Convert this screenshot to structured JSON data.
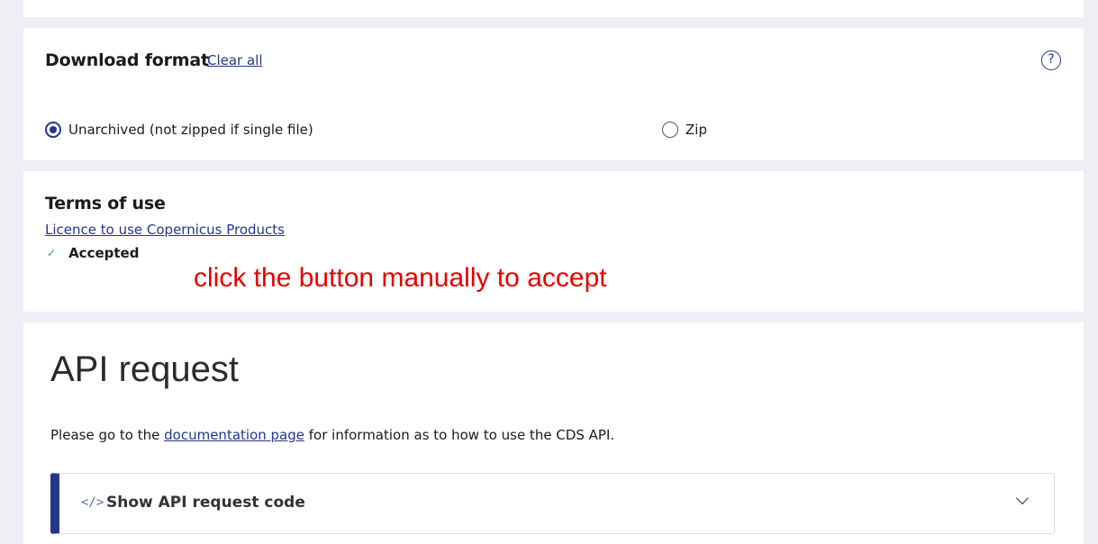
{
  "download_format": {
    "title": "Download format",
    "clear_all": "Clear all",
    "help_icon": "?",
    "options": [
      {
        "label": "Unarchived (not zipped if single file)",
        "selected": true
      },
      {
        "label": "Zip",
        "selected": false
      }
    ]
  },
  "terms": {
    "title": "Terms of use",
    "licence_link": "Licence to use Copernicus Products",
    "check_icon": "✓",
    "status": "Accepted",
    "annotation": "click the button manually to accept"
  },
  "api_request": {
    "title": "API request",
    "desc_before": "Please go to the",
    "desc_link": "documentation page",
    "desc_after": "for information as to how to use the CDS API.",
    "toggle_icon": "</>",
    "toggle_label": "Show API request code"
  },
  "colors": {
    "accent": "#24368c",
    "annotation": "#e60000",
    "background": "#eeeef5",
    "check": "#2e9a4a"
  }
}
